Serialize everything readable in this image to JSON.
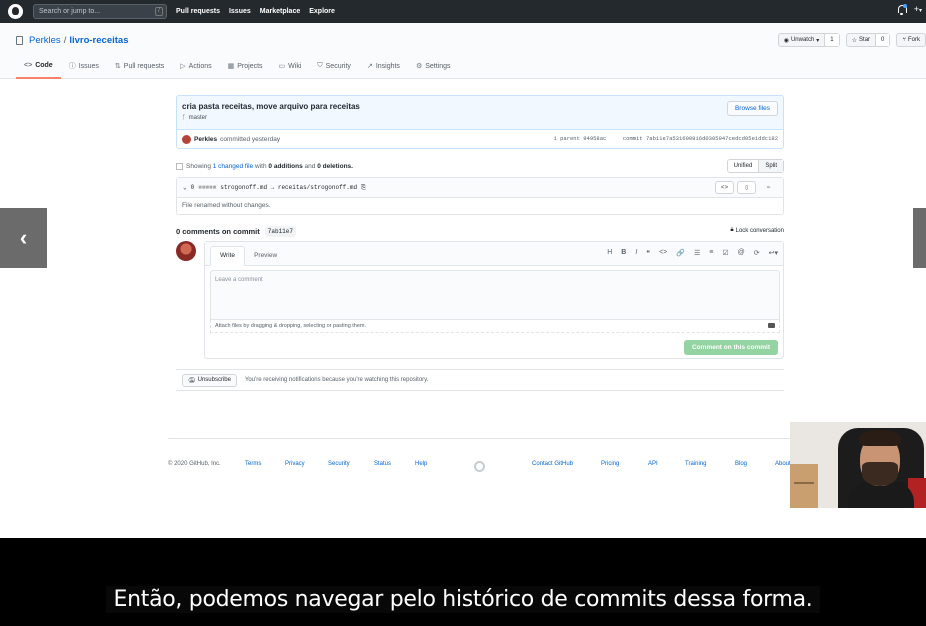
{
  "github": {
    "search_placeholder": "Search or jump to...",
    "search_shortcut": "/",
    "nav": [
      "Pull requests",
      "Issues",
      "Marketplace",
      "Explore"
    ],
    "plus_icon": "+",
    "plus_caret": "▾"
  },
  "repo": {
    "owner": "Perkles",
    "separator": "/",
    "name": "livro-receitas",
    "watch": {
      "label": "Unwatch",
      "count": "1"
    },
    "star": {
      "label": "Star",
      "count": "0"
    },
    "fork": {
      "label": "Fork"
    },
    "tabs": [
      {
        "label": "Code",
        "icon": "<>"
      },
      {
        "label": "Issues",
        "icon": "ⓘ"
      },
      {
        "label": "Pull requests",
        "icon": "⇅"
      },
      {
        "label": "Actions",
        "icon": "▷"
      },
      {
        "label": "Projects",
        "icon": "▦"
      },
      {
        "label": "Wiki",
        "icon": "▭"
      },
      {
        "label": "Security",
        "icon": "⛉"
      },
      {
        "label": "Insights",
        "icon": "↗"
      },
      {
        "label": "Settings",
        "icon": "⚙"
      }
    ]
  },
  "commit": {
    "title": "cria pasta receitas, move arquivo para receitas",
    "branch": "master",
    "browse_label": "Browse files",
    "author": "Perkles",
    "when": "committed yesterday",
    "parent_label": "1 parent",
    "parent_sha": "94958ac",
    "commit_label": "commit",
    "commit_sha": "7ab11e7a531600916d0305947cedcd05e1ddc182"
  },
  "summary": {
    "showing": "Showing",
    "changed": "1 changed file",
    "with": "with",
    "additions": "0 additions",
    "and": "and",
    "deletions": "0 deletions.",
    "unified": "Unified",
    "split": "Split"
  },
  "file": {
    "count": "0",
    "blocks": "■■■■■",
    "path": "strogonoff.md → receitas/strogonoff.md",
    "body": "File renamed without changes."
  },
  "comments": {
    "heading_pre": "0 comments on commit",
    "sha": "7ab11e7",
    "lock": "Lock conversation",
    "write_tab": "Write",
    "preview_tab": "Preview",
    "placeholder": "Leave a comment",
    "attach": "Attach files by dragging & dropping, selecting or pasting them.",
    "submit": "Comment on this commit",
    "toolbar": [
      "H",
      "B",
      "I",
      "❝",
      "<>",
      "🔗",
      "☰",
      "≡",
      "☑",
      "@",
      "⟳",
      "↩▾"
    ]
  },
  "notifications": {
    "unsubscribe": "Unsubscribe",
    "reason": "You're receiving notifications because you're watching this repository."
  },
  "footer": {
    "copyright": "© 2020 GitHub, Inc.",
    "left_links": [
      "Terms",
      "Privacy",
      "Security",
      "Status",
      "Help"
    ],
    "right_links": [
      "Contact GitHub",
      "Pricing",
      "API",
      "Training",
      "Blog",
      "About"
    ]
  },
  "subtitle": "Então, podemos navegar pelo histórico de commits dessa forma.",
  "colors": {
    "header_bg": "#24292e",
    "link": "#0366d6",
    "active_tab_border": "#f9826c",
    "submit_disabled": "#94d3a2",
    "commit_header_bg": "#f1f8ff"
  }
}
